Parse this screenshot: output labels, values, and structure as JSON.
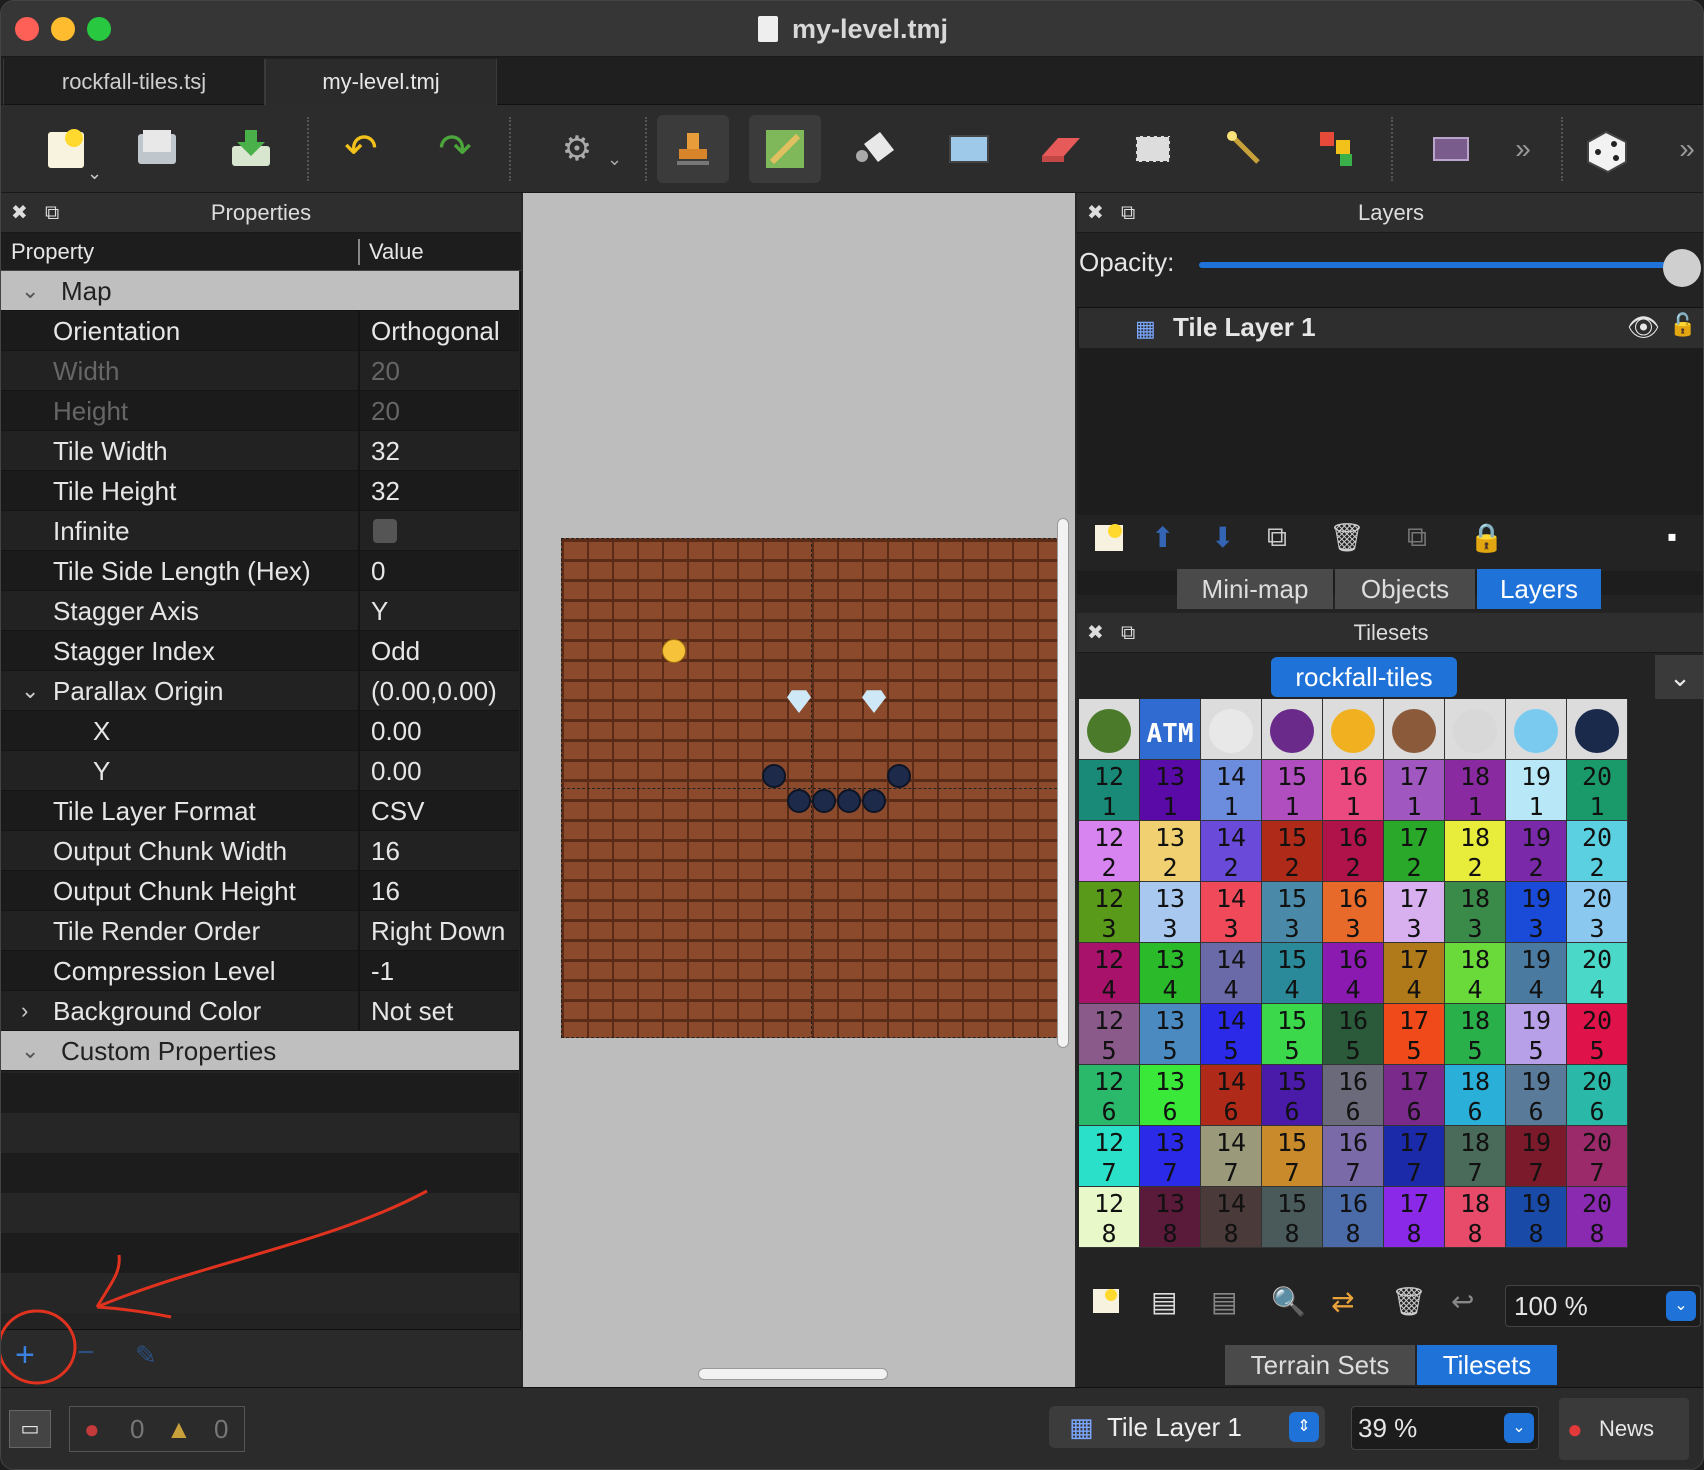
{
  "window": {
    "title": "my-level.tmj"
  },
  "tabs": [
    {
      "label": "rockfall-tiles.tsj"
    },
    {
      "label": "my-level.tmj"
    }
  ],
  "toolbar": {
    "items": [
      "new-icon",
      "open-icon",
      "save-icon",
      "undo-icon",
      "redo-icon",
      "commands-icon",
      "stamp-brush-icon",
      "terrain-brush-icon",
      "bucket-fill-icon",
      "shape-fill-icon",
      "eraser-icon",
      "rect-select-icon",
      "magic-wand-icon",
      "select-same-tile-icon",
      "insert-template-icon",
      "more-icon",
      "random-mode-icon"
    ]
  },
  "properties": {
    "panel_title": "Properties",
    "col_property": "Property",
    "col_value": "Value",
    "group_map": "Map",
    "rows": [
      {
        "name": "Orientation",
        "value": "Orthogonal"
      },
      {
        "name": "Width",
        "value": "20"
      },
      {
        "name": "Height",
        "value": "20"
      },
      {
        "name": "Tile Width",
        "value": "32"
      },
      {
        "name": "Tile Height",
        "value": "32"
      },
      {
        "name": "Infinite",
        "value": ""
      },
      {
        "name": "Tile Side Length (Hex)",
        "value": "0"
      },
      {
        "name": "Stagger Axis",
        "value": "Y"
      },
      {
        "name": "Stagger Index",
        "value": "Odd"
      },
      {
        "name": "Parallax Origin",
        "value": "(0.00,0.00)"
      },
      {
        "name": "X",
        "value": "0.00"
      },
      {
        "name": "Y",
        "value": "0.00"
      },
      {
        "name": "Tile Layer Format",
        "value": "CSV"
      },
      {
        "name": "Output Chunk Width",
        "value": "16"
      },
      {
        "name": "Output Chunk Height",
        "value": "16"
      },
      {
        "name": "Tile Render Order",
        "value": "Right Down"
      },
      {
        "name": "Compression Level",
        "value": "-1"
      },
      {
        "name": "Background Color",
        "value": "Not set"
      }
    ],
    "group_custom": "Custom Properties"
  },
  "layers": {
    "panel_title": "Layers",
    "opacity_label": "Opacity:",
    "opacity": 1.0,
    "layer_name": "Tile Layer 1",
    "tabs": [
      "Mini-map",
      "Objects",
      "Layers"
    ]
  },
  "tilesets": {
    "panel_title": "Tilesets",
    "active_tileset": "rockfall-tiles",
    "zoom": "100 %",
    "tabs": [
      "Terrain Sets",
      "Tilesets"
    ],
    "header_tiles": [
      "virus",
      "ATM",
      "egg",
      "eggplant",
      "chick",
      "coconut",
      "blank",
      "gem",
      "rock"
    ],
    "columns": [
      "12",
      "13",
      "14",
      "15",
      "16",
      "17",
      "18",
      "19",
      "20"
    ],
    "rows": [
      "1",
      "2",
      "3",
      "4",
      "5",
      "6",
      "7",
      "8"
    ]
  },
  "status": {
    "errors": "0",
    "warnings": "0",
    "current_layer": "Tile Layer 1",
    "zoom": "39 %",
    "news": "News"
  },
  "colors": {
    "accent": "#1f73d8",
    "annotation": "#e0321e"
  }
}
